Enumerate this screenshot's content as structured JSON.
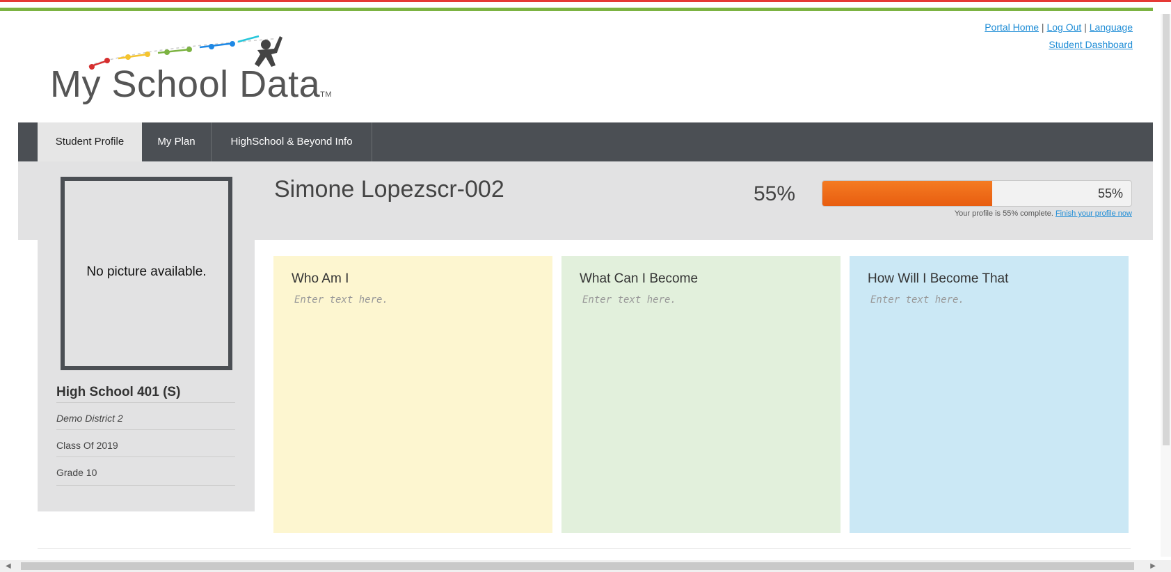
{
  "logo": {
    "text": "My School Data",
    "tm": "TM"
  },
  "top_links": {
    "portal_home": "Portal Home",
    "log_out": "Log Out",
    "language": "Language",
    "separator": "|",
    "student_dashboard": "Student Dashboard"
  },
  "tabs": [
    {
      "label": "Student Profile",
      "active": true
    },
    {
      "label": "My Plan",
      "active": false
    },
    {
      "label": "HighSchool & Beyond Info",
      "active": false
    }
  ],
  "sidebar": {
    "photo_placeholder": "No picture available.",
    "school": "High School 401 (S)",
    "district": "Demo District 2",
    "class_of": "Class Of 2019",
    "grade": "Grade 10"
  },
  "profile": {
    "student_name": "Simone Lopezscr-002",
    "completion_percent": 55,
    "completion_label": "55%",
    "bar_label": "55%",
    "note_text": "Your profile is 55% complete.",
    "note_link": "Finish your profile now"
  },
  "cards": [
    {
      "title": "Who Am I",
      "placeholder": "Enter text here.",
      "color": "#fdf6d0"
    },
    {
      "title": "What Can I Become",
      "placeholder": "Enter text here.",
      "color": "#e2f0dc"
    },
    {
      "title": "How Will I Become That",
      "placeholder": "Enter text here.",
      "color": "#cbe8f5"
    }
  ],
  "colors": {
    "accent_green": "#7cb342",
    "navbar": "#4b4f54",
    "progress": "#f47b22",
    "link": "#1f8dd6"
  }
}
